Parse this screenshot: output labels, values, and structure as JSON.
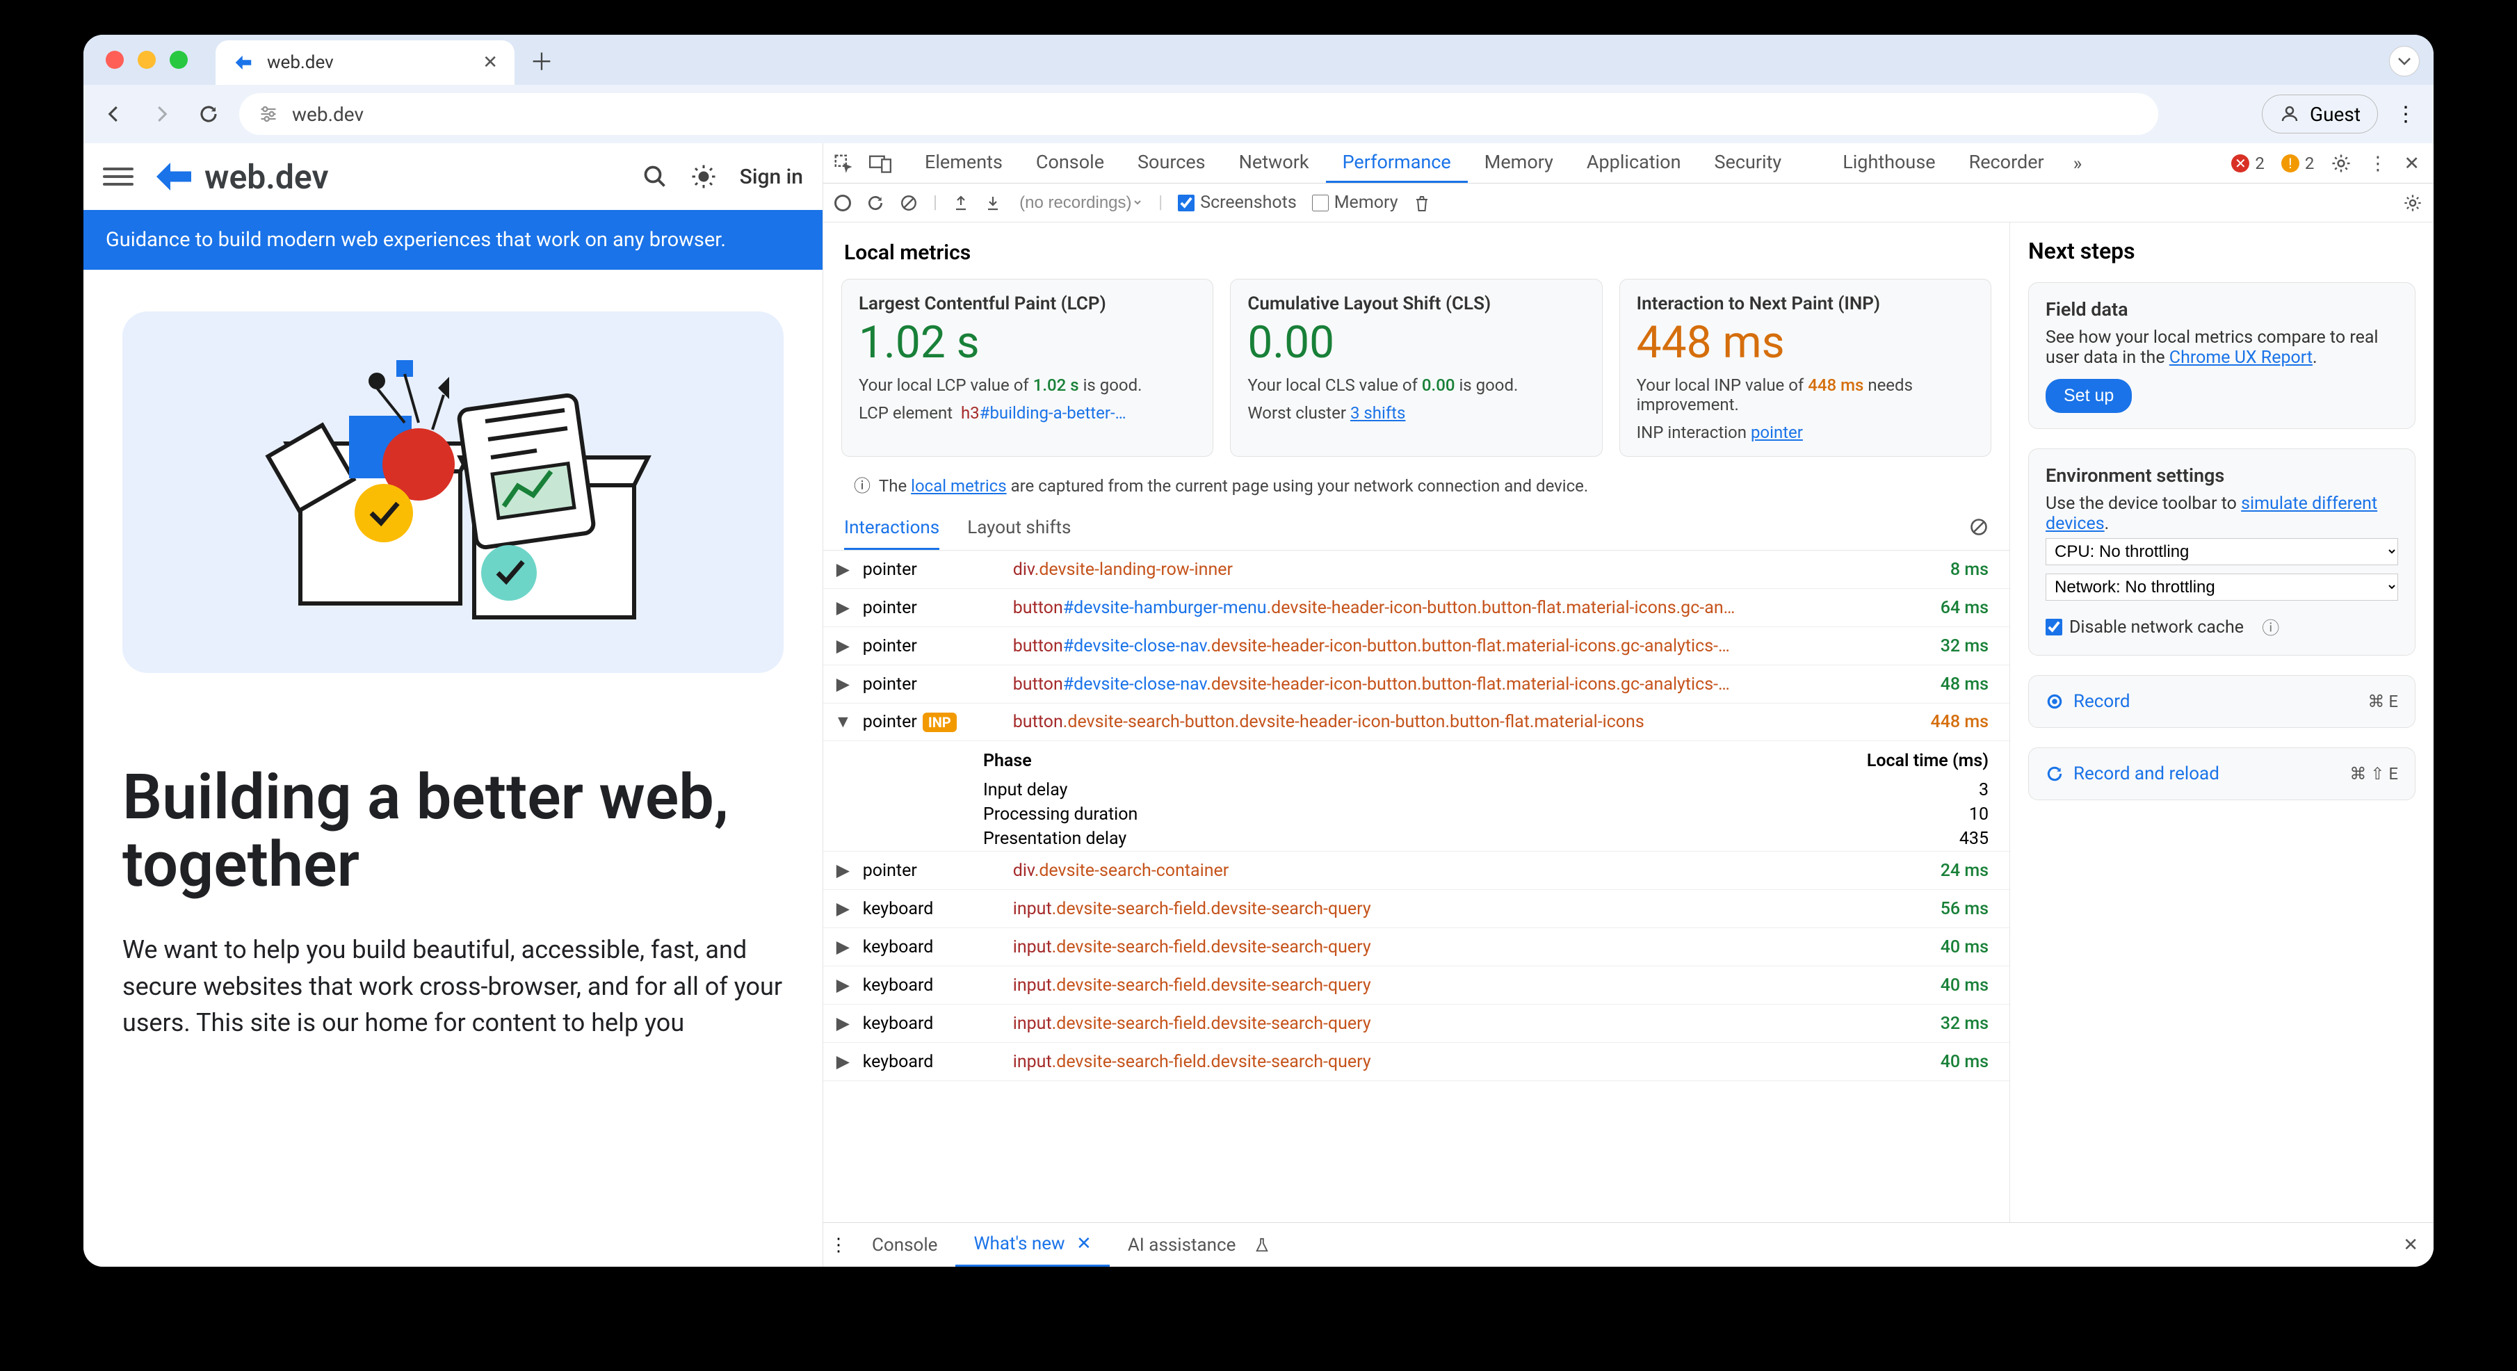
{
  "browser": {
    "tab_title": "web.dev",
    "url": "web.dev",
    "guest_label": "Guest"
  },
  "site": {
    "logo_text": "web.dev",
    "signin": "Sign in",
    "banner": "Guidance to build modern web experiences that work on any browser.",
    "hero_title": "Building a better web, together",
    "hero_text": "We want to help you build beautiful, accessible, fast, and secure websites that work cross-browser, and for all of your users. This site is our home for content to help you"
  },
  "devtools": {
    "tabs": [
      "Elements",
      "Console",
      "Sources",
      "Network",
      "Performance",
      "Memory",
      "Application",
      "Security",
      "Lighthouse",
      "Recorder"
    ],
    "active_tab": "Performance",
    "errors": "2",
    "warnings": "2",
    "perf_bar": {
      "recordings": "(no recordings)",
      "screenshots_label": "Screenshots",
      "memory_label": "Memory"
    },
    "local_metrics_title": "Local metrics",
    "metrics": {
      "lcp": {
        "title": "Largest Contentful Paint (LCP)",
        "value": "1.02 s",
        "desc_pre": "Your local LCP value of ",
        "desc_val": "1.02 s",
        "desc_post": " is good.",
        "sub_label": "LCP element",
        "sub_sel_tag": "h3",
        "sub_sel_rest": "#building-a-better-…"
      },
      "cls": {
        "title": "Cumulative Layout Shift (CLS)",
        "value": "0.00",
        "desc_pre": "Your local CLS value of ",
        "desc_val": "0.00",
        "desc_post": " is good.",
        "sub_label": "Worst cluster",
        "sub_link": "3 shifts"
      },
      "inp": {
        "title": "Interaction to Next Paint (INP)",
        "value": "448 ms",
        "desc_pre": "Your local INP value of ",
        "desc_val": "448 ms",
        "desc_post": " needs improvement.",
        "sub_label": "INP interaction",
        "sub_link": "pointer"
      }
    },
    "note_pre": "The ",
    "note_link": "local metrics",
    "note_post": " are captured from the current page using your network connection and device.",
    "subtabs": {
      "interactions": "Interactions",
      "layout": "Layout shifts"
    },
    "phase": {
      "head_l": "Phase",
      "head_r": "Local time (ms)",
      "rows": [
        {
          "l": "Input delay",
          "r": "3"
        },
        {
          "l": "Processing duration",
          "r": "10"
        },
        {
          "l": "Presentation delay",
          "r": "435"
        }
      ]
    },
    "interactions": [
      {
        "type": "pointer",
        "tag": "div",
        "cls": ".devsite-landing-row-inner",
        "time": "8 ms"
      },
      {
        "type": "pointer",
        "tag": "button",
        "id": "#devsite-hamburger-menu",
        "cls": ".devsite-header-icon-button.button-flat.material-icons.gc-an…",
        "time": "64 ms"
      },
      {
        "type": "pointer",
        "tag": "button",
        "id": "#devsite-close-nav",
        "cls": ".devsite-header-icon-button.button-flat.material-icons.gc-analytics-…",
        "time": "32 ms"
      },
      {
        "type": "pointer",
        "tag": "button",
        "id": "#devsite-close-nav",
        "cls": ".devsite-header-icon-button.button-flat.material-icons.gc-analytics-…",
        "time": "48 ms"
      },
      {
        "type": "pointer",
        "inp": true,
        "tag": "button",
        "cls": ".devsite-search-button.devsite-header-icon-button.button-flat.material-icons",
        "time": "448 ms"
      },
      {
        "type": "pointer",
        "tag": "div",
        "cls": ".devsite-search-container",
        "time": "24 ms"
      },
      {
        "type": "keyboard",
        "tag": "input",
        "cls": ".devsite-search-field.devsite-search-query",
        "time": "56 ms"
      },
      {
        "type": "keyboard",
        "tag": "input",
        "cls": ".devsite-search-field.devsite-search-query",
        "time": "40 ms"
      },
      {
        "type": "keyboard",
        "tag": "input",
        "cls": ".devsite-search-field.devsite-search-query",
        "time": "40 ms"
      },
      {
        "type": "keyboard",
        "tag": "input",
        "cls": ".devsite-search-field.devsite-search-query",
        "time": "32 ms"
      },
      {
        "type": "keyboard",
        "tag": "input",
        "cls": ".devsite-search-field.devsite-search-query",
        "time": "40 ms"
      }
    ]
  },
  "next_steps": {
    "title": "Next steps",
    "field_data": {
      "h": "Field data",
      "text_pre": "See how your local metrics compare to real user data in the ",
      "link": "Chrome UX Report",
      "setup": "Set up"
    },
    "env": {
      "h": "Environment settings",
      "text_pre": "Use the device toolbar to ",
      "link": "simulate different devices",
      "cpu": "CPU: No throttling",
      "net": "Network: No throttling",
      "cache": "Disable network cache"
    },
    "record": {
      "label": "Record",
      "kbd": "⌘ E"
    },
    "reload": {
      "label": "Record and reload",
      "kbd": "⌘ ⇧ E"
    }
  },
  "drawer": {
    "console": "Console",
    "whatsnew": "What's new",
    "ai": "AI assistance"
  }
}
